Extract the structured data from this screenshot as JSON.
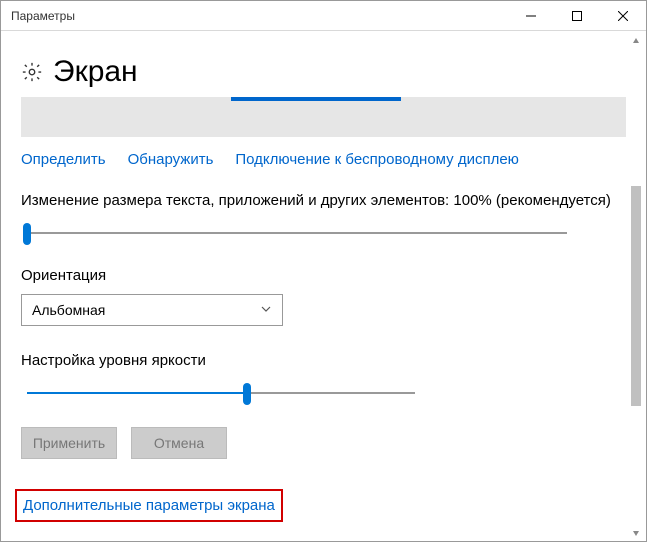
{
  "window": {
    "title": "Параметры"
  },
  "header": {
    "title": "Экран"
  },
  "links": {
    "identify": "Определить",
    "detect": "Обнаружить",
    "wireless": "Подключение к беспроводному дисплею"
  },
  "scale": {
    "label": "Изменение размера текста, приложений и других элементов: 100% (рекомендуется)",
    "value_percent": 0
  },
  "orientation": {
    "label": "Ориентация",
    "selected": "Альбомная"
  },
  "brightness": {
    "label": "Настройка уровня яркости",
    "value_percent": 57
  },
  "buttons": {
    "apply": "Применить",
    "cancel": "Отмена"
  },
  "advanced_link": "Дополнительные параметры экрана"
}
